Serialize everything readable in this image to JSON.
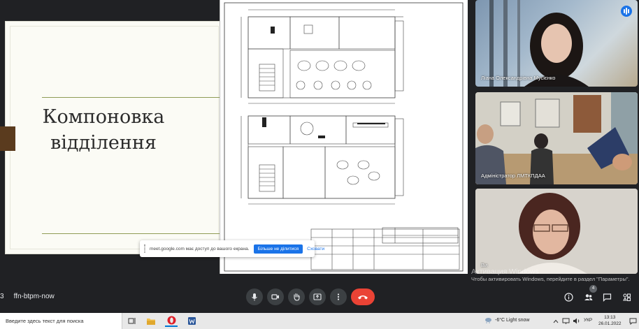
{
  "slide": {
    "title": "Компоновка відділення"
  },
  "share_banner": {
    "message": "meet.google.com має доступ до вашого екрана.",
    "stop_label": "Більше не ділитися",
    "hide_label": "Сховати"
  },
  "participants": [
    {
      "name": "Ліана Олександрівна Мусієнко"
    },
    {
      "name": "Адміністратор ЛМТКПДАА"
    },
    {
      "name": "Ви"
    }
  ],
  "bottom_bar": {
    "time_fragment": "3",
    "meeting_code": "ffn-btpm-now",
    "people_count": "4"
  },
  "activation_watermark": {
    "line1": "Активация Windows",
    "line2": "Чтобы активировать Windows, перейдите в раздел \"Параметры\"."
  },
  "taskbar": {
    "search_placeholder": "Введите здесь текст для поиска",
    "weather": "-6°C  Light snow",
    "language": "УКР",
    "time": "13:13",
    "date": "26.01.2022"
  },
  "colors": {
    "accent": "#1a73e8",
    "hangup": "#ea4335",
    "slide_line": "#8f9b55",
    "slide_bar": "#5a3b1e"
  }
}
